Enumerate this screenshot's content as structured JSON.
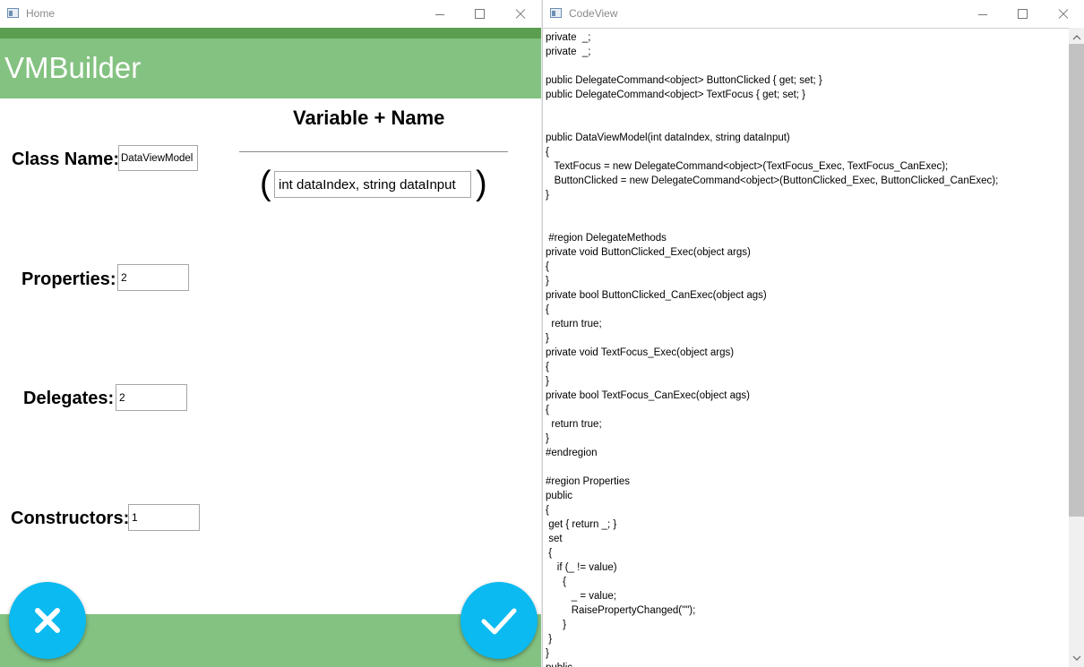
{
  "home_window": {
    "title": "Home",
    "app_title": "VMBuilder",
    "class_name_label": "Class Name:",
    "class_name_value": "DataViewModel",
    "properties_label": "Properties:",
    "properties_value": "2",
    "delegates_label": "Delegates:",
    "delegates_value": "2",
    "constructors_label": "Constructors:",
    "constructors_value": "1",
    "section_title": "Variable + Name",
    "open_paren": "(",
    "close_paren": ")",
    "constructor_params": "int dataIndex, string dataInput",
    "cancel_icon": "close-icon",
    "confirm_icon": "check-icon",
    "fab_color": "#0abaf0",
    "header_color": "#84c281"
  },
  "code_window": {
    "title": "CodeView",
    "lines": [
      "private  _;",
      "private  _;",
      "",
      "public DelegateCommand<object> ButtonClicked { get; set; }",
      "public DelegateCommand<object> TextFocus { get; set; }",
      "",
      "",
      "public DataViewModel(int dataIndex, string dataInput)",
      "{",
      "   TextFocus = new DelegateCommand<object>(TextFocus_Exec, TextFocus_CanExec);",
      "   ButtonClicked = new DelegateCommand<object>(ButtonClicked_Exec, ButtonClicked_CanExec);",
      "}",
      "",
      "",
      " #region DelegateMethods",
      "private void ButtonClicked_Exec(object args)",
      "{",
      "}",
      "private bool ButtonClicked_CanExec(object ags)",
      "{",
      "  return true;",
      "}",
      "private void TextFocus_Exec(object args)",
      "{",
      "}",
      "private bool TextFocus_CanExec(object ags)",
      "{",
      "  return true;",
      "}",
      "#endregion",
      "",
      "#region Properties",
      "public",
      "{",
      " get { return _; }",
      " set",
      " {",
      "    if (_ != value)",
      "      {",
      "         _ = value;",
      "         RaisePropertyChanged(\"\");",
      "      }",
      " }",
      "}",
      "public"
    ]
  }
}
